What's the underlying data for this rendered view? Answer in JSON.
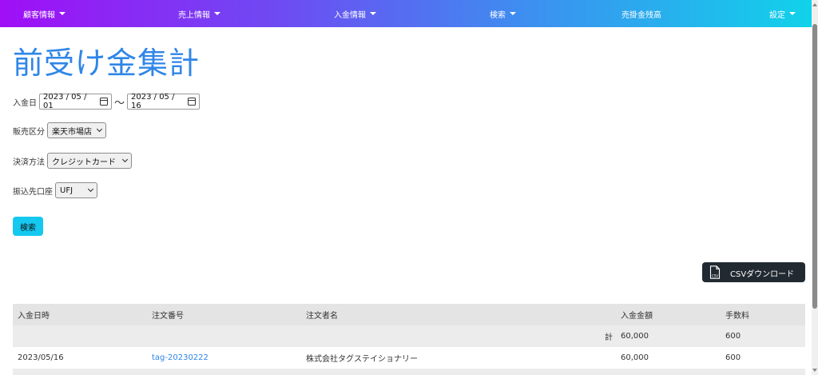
{
  "nav": {
    "items": [
      {
        "label": "顧客情報",
        "dropdown": true
      },
      {
        "label": "売上情報",
        "dropdown": true
      },
      {
        "label": "入金情報",
        "dropdown": true
      },
      {
        "label": "検索",
        "dropdown": true
      },
      {
        "label": "売掛金残高",
        "dropdown": false
      },
      {
        "label": "設定",
        "dropdown": true
      }
    ]
  },
  "page": {
    "title": "前受け金集計"
  },
  "form": {
    "date_label": "入金日",
    "date_from": "2023 / 05 / 01",
    "date_separator": "〜",
    "date_to": "2023 / 05 / 16",
    "sales_category_label": "販売区分",
    "sales_category_value": "楽天市場店",
    "payment_method_label": "決済方法",
    "payment_method_value": "クレジットカード",
    "bank_account_label": "振込先口座",
    "bank_account_value": "UFJ",
    "search_button": "検索"
  },
  "csv_button": {
    "label": "CSVダウンロード",
    "icon": "csv-file-icon",
    "icon_text": "CSV"
  },
  "table": {
    "columns": [
      "入金日時",
      "注文番号",
      "注文者名",
      "入金金額",
      "手数料"
    ],
    "total_row": {
      "label": "計",
      "amount": "60,000",
      "fee": "600"
    },
    "rows": [
      {
        "date": "2023/05/16",
        "order_no": "tag-20230222",
        "customer": "株式会社タグステイショナリー",
        "amount": "60,000",
        "fee": "600"
      }
    ]
  },
  "colors": {
    "nav_gradient_start": "#a00ef6",
    "nav_gradient_end": "#11d2ea",
    "title": "#2f86e8",
    "search_button": "#14c8ef",
    "csv_button": "#222a31",
    "link": "#2f86e8"
  }
}
